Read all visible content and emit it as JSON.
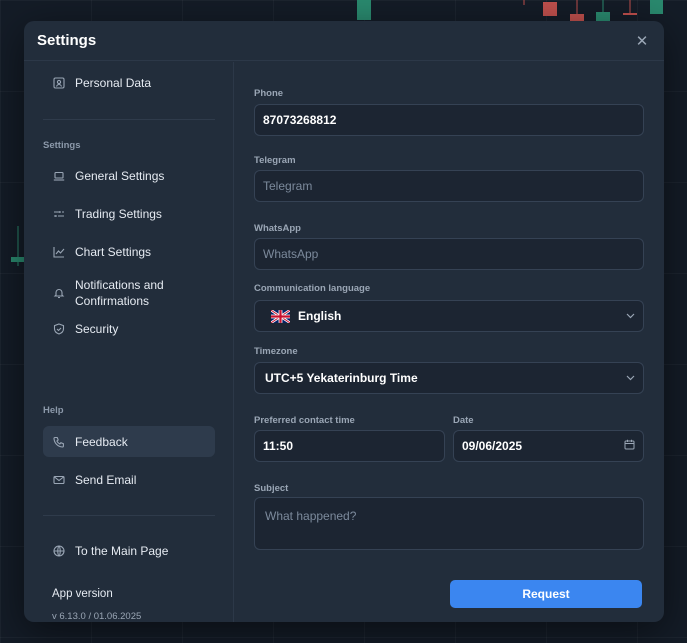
{
  "modal": {
    "title": "Settings",
    "close_icon": "close-icon"
  },
  "sidebar": {
    "personal_data_label": "Personal Data",
    "settings_heading": "Settings",
    "settings_items": [
      {
        "label": "General Settings",
        "icon": "laptop-icon"
      },
      {
        "label": "Trading Settings",
        "icon": "sliders-icon"
      },
      {
        "label": "Chart Settings",
        "icon": "chart-line-icon"
      },
      {
        "label": "Notifications and Confirmations",
        "icon": "bell-icon"
      },
      {
        "label": "Security",
        "icon": "shield-icon"
      }
    ],
    "help_heading": "Help",
    "help_items": [
      {
        "label": "Feedback",
        "icon": "phone-icon",
        "active": true
      },
      {
        "label": "Send Email",
        "icon": "mail-icon",
        "active": false
      }
    ],
    "main_page_label": "To the Main Page",
    "app_version_label": "App version",
    "app_version_value": "v 6.13.0 / 01.06.2025"
  },
  "form": {
    "phone_label": "Phone",
    "phone_value": "87073268812",
    "telegram_label": "Telegram",
    "telegram_placeholder": "Telegram",
    "whatsapp_label": "WhatsApp",
    "whatsapp_placeholder": "WhatsApp",
    "language_label": "Communication language",
    "language_value": "English",
    "timezone_label": "Timezone",
    "timezone_value": "UTC+5 Yekaterinburg Time",
    "contact_time_label": "Preferred contact time",
    "contact_time_value": "11:50",
    "date_label": "Date",
    "date_value": "09/06/2025",
    "subject_label": "Subject",
    "subject_placeholder": "What happened?",
    "request_button": "Request"
  },
  "colors": {
    "accent": "#3b86f0",
    "modal_bg": "#222d3b",
    "page_bg": "#141c27",
    "bull": "#2a8a6f",
    "bear": "#c0504d"
  }
}
